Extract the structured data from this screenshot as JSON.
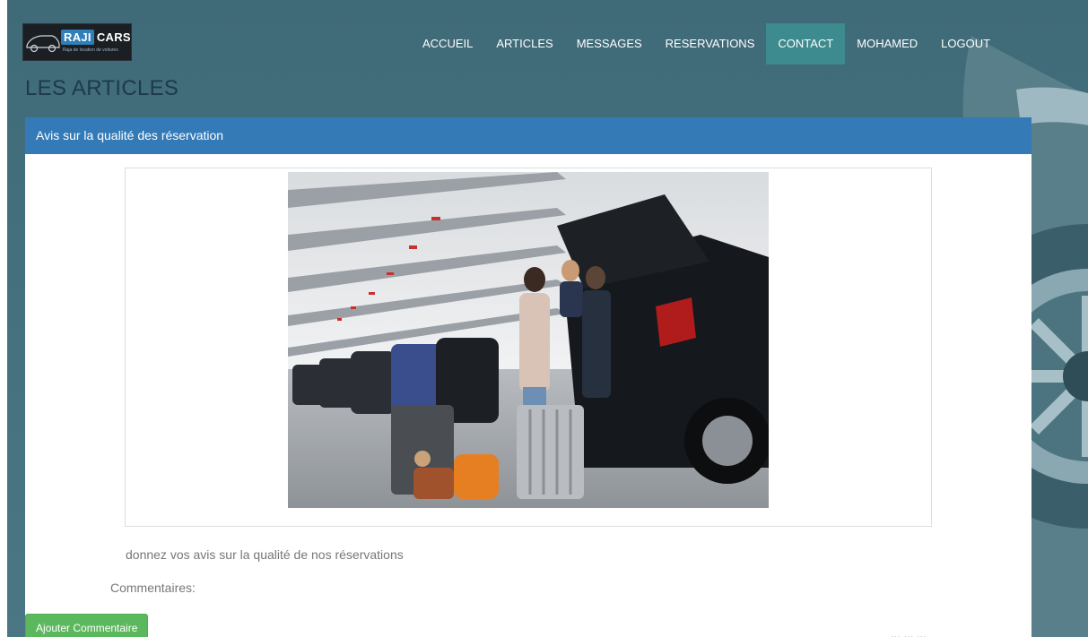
{
  "brand": {
    "name_highlight": "RAJI",
    "name_rest": "CARS",
    "tagline": "Raja de location de voitures"
  },
  "nav": {
    "items": [
      {
        "label": "ACCUEIL"
      },
      {
        "label": "ARTICLES"
      },
      {
        "label": "MESSAGES"
      },
      {
        "label": "RESERVATIONS"
      },
      {
        "label": "CONTACT"
      },
      {
        "label": "MOHAMED"
      },
      {
        "label": "LOGOUT"
      }
    ],
    "active": "CONTACT"
  },
  "page": {
    "title": "LES ARTICLES"
  },
  "article": {
    "heading": "Avis sur la qualité des réservation",
    "image_alt": "family-loading-suitcases-parking-garage-photo",
    "description": "donnez vos avis sur la qualité de nos réservations",
    "comments_label": "Commentaires:",
    "add_comment_button": "Ajouter Commentaire",
    "cut_off_text": "... ... ..."
  },
  "colors": {
    "background": "#44707e",
    "panel_heading": "#337ab7",
    "nav_active": "#3d8a8f",
    "button_green": "#5cb85c",
    "title": "#1e3a4a"
  }
}
